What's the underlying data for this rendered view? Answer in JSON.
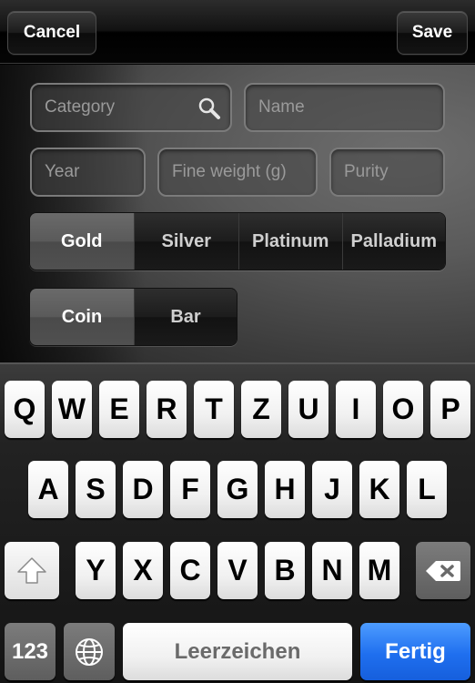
{
  "navbar": {
    "cancel_label": "Cancel",
    "save_label": "Save"
  },
  "form": {
    "category_placeholder": "Category",
    "name_placeholder": "Name",
    "year_placeholder": "Year",
    "weight_placeholder": "Fine weight (g)",
    "purity_placeholder": "Purity",
    "metal_segments": [
      "Gold",
      "Silver",
      "Platinum",
      "Palladium"
    ],
    "metal_selected": "Gold",
    "type_segments": [
      "Coin",
      "Bar"
    ],
    "type_selected": "Coin"
  },
  "icons": {
    "search": "search-icon",
    "shift": "shift-icon",
    "delete": "backspace-icon",
    "globe": "globe-icon"
  },
  "keyboard": {
    "row1": [
      "Q",
      "W",
      "E",
      "R",
      "T",
      "Z",
      "U",
      "I",
      "O",
      "P"
    ],
    "row2": [
      "A",
      "S",
      "D",
      "F",
      "G",
      "H",
      "J",
      "K",
      "L"
    ],
    "row3": [
      "Y",
      "X",
      "C",
      "V",
      "B",
      "N",
      "M"
    ],
    "numbers_label": "123",
    "space_label": "Leerzeichen",
    "done_label": "Fertig"
  },
  "colors": {
    "done_key": "#1f6fef",
    "selected_segment": "#5a5a5a"
  }
}
